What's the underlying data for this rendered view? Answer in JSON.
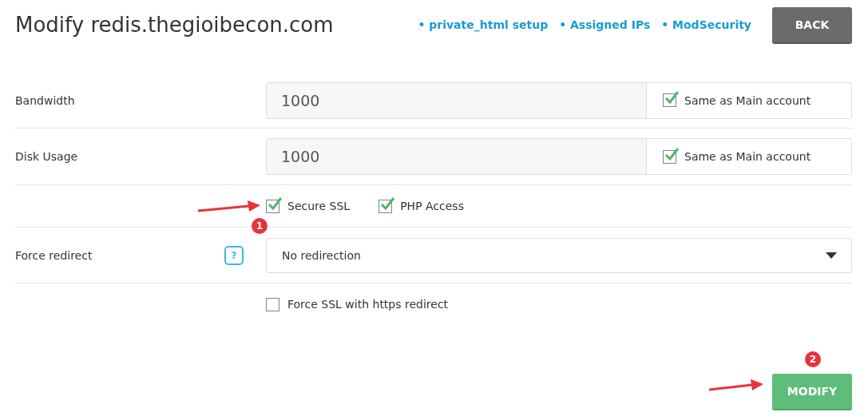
{
  "title": "Modify redis.thegioibecon.com",
  "links": [
    "• private_html setup",
    "• Assigned IPs",
    "• ModSecurity"
  ],
  "back_button": "BACK",
  "limits": [
    {
      "label": "Bandwidth",
      "value": "1000",
      "same_as_main": {
        "label": "Same as Main account",
        "checked": true
      }
    },
    {
      "label": "Disk Usage",
      "value": "1000",
      "same_as_main": {
        "label": "Same as Main account",
        "checked": true
      }
    }
  ],
  "options": [
    {
      "label": "Secure SSL",
      "checked": true
    },
    {
      "label": "PHP Access",
      "checked": true
    }
  ],
  "force_redirect": {
    "label": "Force redirect",
    "help": "?",
    "value": "No redirection"
  },
  "force_ssl": {
    "label": "Force SSL with https redirect",
    "checked": false
  },
  "modify_button": "MODIFY",
  "annotations": [
    {
      "number": "1"
    },
    {
      "number": "2"
    }
  ]
}
